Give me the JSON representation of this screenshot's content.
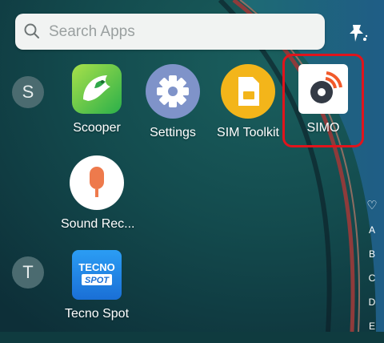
{
  "search": {
    "placeholder": "Search Apps"
  },
  "sections": [
    {
      "letter": "S"
    },
    {
      "letter": "T"
    }
  ],
  "apps": [
    {
      "label": "Scooper",
      "icon": "scooper-bird-icon"
    },
    {
      "label": "Settings",
      "icon": "gear-icon"
    },
    {
      "label": "SIM Toolkit",
      "icon": "sim-card-icon"
    },
    {
      "label": "SIMO",
      "icon": "simo-logo-icon"
    },
    {
      "label": "Sound Rec...",
      "icon": "microphone-icon"
    },
    {
      "label": "Tecno Spot",
      "icon": "tecno-spot-icon"
    }
  ],
  "alpha_index": [
    "♡",
    "A",
    "B",
    "C",
    "D",
    "E"
  ],
  "highlight_color": "#e0141c"
}
